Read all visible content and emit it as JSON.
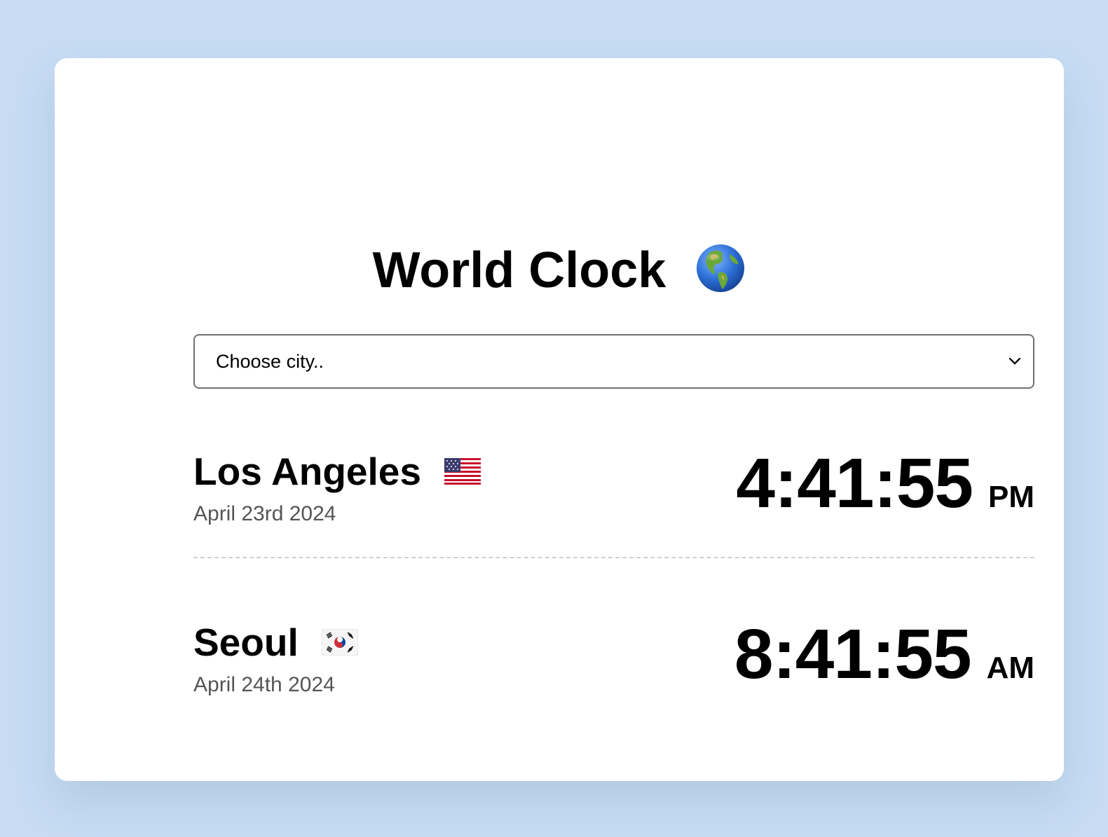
{
  "app": {
    "title": "World Clock"
  },
  "selector": {
    "selected": "Choose city.."
  },
  "cities": [
    {
      "name": "Los Angeles",
      "flag": "us-flag-icon",
      "date": "April 23rd 2024",
      "time": "4:41:55",
      "period": "PM"
    },
    {
      "name": "Seoul",
      "flag": "kr-flag-icon",
      "date": "April 24th 2024",
      "time": "8:41:55",
      "period": "AM"
    }
  ],
  "icons": {
    "title_icon": "globe-americas-icon",
    "dropdown_icon": "chevron-down-icon"
  },
  "colors": {
    "background": "#c7dcf3",
    "card": "#ffffff",
    "date_text": "#555555",
    "divider": "#cfcfcf"
  }
}
